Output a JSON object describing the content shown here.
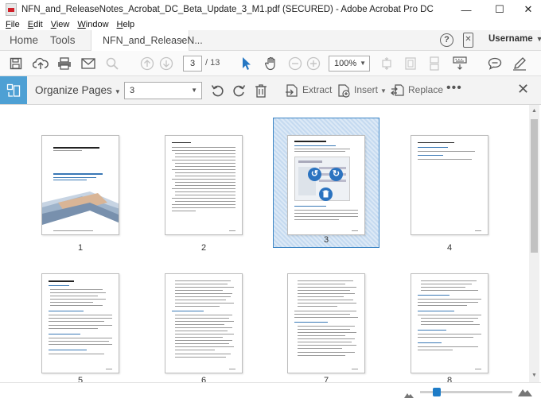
{
  "window": {
    "title": "NFN_and_ReleaseNotes_Acrobat_DC_Beta_Update_3_M1.pdf (SECURED) - Adobe Acrobat Pro DC",
    "minimize": "—",
    "maximize": "☐",
    "close": "✕"
  },
  "menu": [
    {
      "key": "F",
      "rest": "ile"
    },
    {
      "key": "E",
      "rest": "dit"
    },
    {
      "key": "V",
      "rest": "iew"
    },
    {
      "key": "W",
      "rest": "indow"
    },
    {
      "key": "H",
      "rest": "elp"
    }
  ],
  "tabs": {
    "home": "Home",
    "tools": "Tools",
    "document": "NFN_and_ReleaseN...",
    "close": "×"
  },
  "header": {
    "help": "?",
    "username": "Username"
  },
  "toolbar": {
    "current_page": "3",
    "total_pages": "/ 13",
    "zoom": "100%"
  },
  "organize": {
    "title": "Organize Pages",
    "page_range": "3",
    "extract": "Extract",
    "insert": "Insert",
    "replace": "Replace",
    "more": "•••",
    "close": "✕"
  },
  "thumbnails": [
    {
      "number": "1",
      "selected": false
    },
    {
      "number": "2",
      "selected": false
    },
    {
      "number": "3",
      "selected": true
    },
    {
      "number": "4",
      "selected": false
    },
    {
      "number": "5",
      "selected": false
    },
    {
      "number": "6",
      "selected": false
    },
    {
      "number": "7",
      "selected": false
    },
    {
      "number": "8",
      "selected": false
    }
  ],
  "colors": {
    "accent": "#1e7cc7",
    "organize_tile": "#4ea0d4",
    "selection_border": "#3d86c6"
  }
}
